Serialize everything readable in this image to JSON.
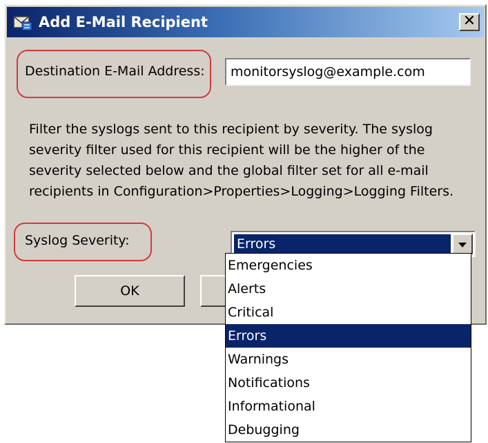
{
  "window": {
    "title": "Add E-Mail Recipient",
    "close_glyph": "✕"
  },
  "form": {
    "destination_label": "Destination E-Mail Address:",
    "destination_value": "monitorsyslog@example.com",
    "description": "Filter the syslogs sent to this recipient by severity. The syslog severity filter used for this recipient will be the higher of the severity selected below and the global filter set for all e-mail recipients in Configuration>Properties>Logging>Logging Filters.",
    "severity_label": "Syslog Severity:",
    "severity_selected": "Errors"
  },
  "buttons": {
    "ok_label": "OK"
  },
  "dropdown": {
    "options": [
      "Emergencies",
      "Alerts",
      "Critical",
      "Errors",
      "Warnings",
      "Notifications",
      "Informational",
      "Debugging"
    ],
    "highlighted": "Errors"
  },
  "colors": {
    "title_bar": "#0a246a",
    "selection": "#0a246a",
    "highlight_outline": "#d23a3a",
    "dialog_bg": "#d4d0c8"
  }
}
